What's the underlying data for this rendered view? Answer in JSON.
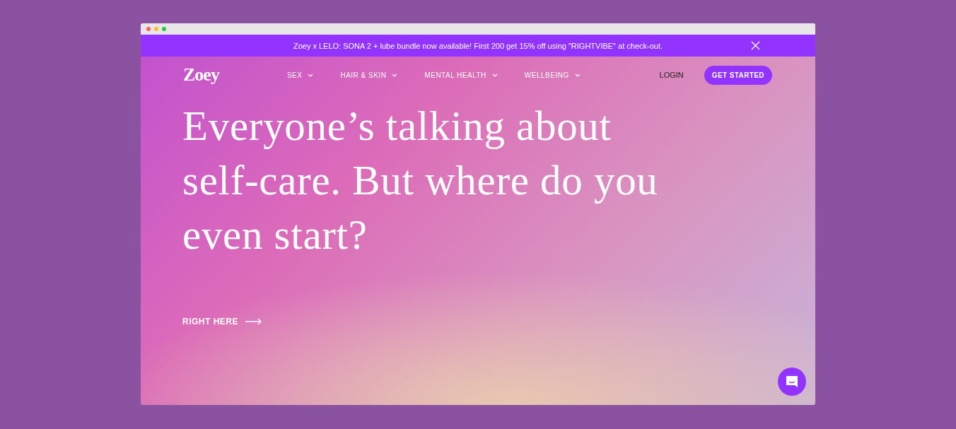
{
  "banner": {
    "text": "Zoey x LELO: SONA 2 + lube bundle now available! First 200 get 15% off using \"RIGHTVIBE\" at check-out."
  },
  "nav": {
    "logo": "Zoey",
    "items": [
      {
        "label": "SEX"
      },
      {
        "label": "HAIR & SKIN"
      },
      {
        "label": "MENTAL HEALTH"
      },
      {
        "label": "WELLBEING"
      }
    ],
    "login": "LOGIN",
    "cta": "GET STARTED"
  },
  "hero": {
    "heading": "Everyone’s talking about self-care. But where do you even start?",
    "link": "RIGHT HERE"
  }
}
